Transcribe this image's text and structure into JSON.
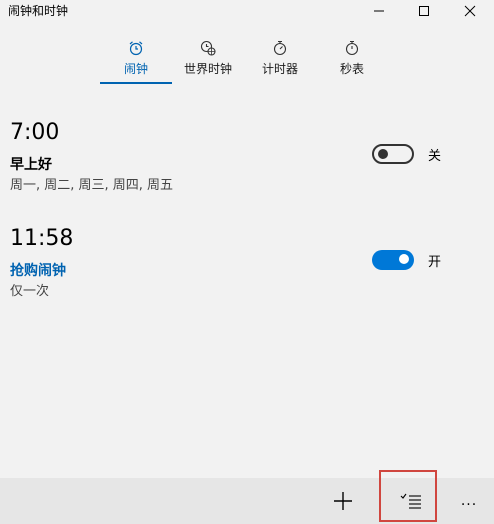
{
  "app": {
    "title": "闹钟和时钟"
  },
  "tabs": [
    {
      "label": "闹钟",
      "icon": "alarm-clock-icon",
      "active": true
    },
    {
      "label": "世界时钟",
      "icon": "world-clock-icon",
      "active": false
    },
    {
      "label": "计时器",
      "icon": "timer-icon",
      "active": false
    },
    {
      "label": "秒表",
      "icon": "stopwatch-icon",
      "active": false
    }
  ],
  "alarms": [
    {
      "time": "7:00",
      "name": "早上好",
      "repeat": "周一, 周二, 周三, 周四, 周五",
      "enabled": false,
      "state_label": "关"
    },
    {
      "time": "11:58",
      "name": "抢购闹钟",
      "repeat": "仅一次",
      "enabled": true,
      "state_label": "开"
    }
  ],
  "colors": {
    "accent": "#0063b1",
    "toggle_on": "#0078d7",
    "background": "#f2f2f2",
    "highlight": "#d0463f"
  },
  "bottom_bar": {
    "buttons": [
      "add-icon",
      "select-list-icon",
      "more-icon"
    ],
    "more_label": "..."
  }
}
